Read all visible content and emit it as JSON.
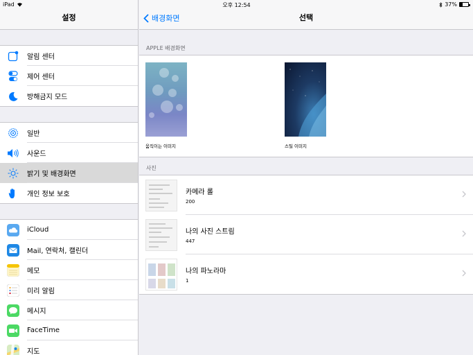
{
  "status": {
    "device": "iPad",
    "time": "오후 12:54",
    "battery": "37%",
    "battery_level": 0.37
  },
  "sidebar": {
    "title": "설정",
    "groups": [
      [
        {
          "label": "알림 센터",
          "icon": "notification-center-icon"
        },
        {
          "label": "제어 센터",
          "icon": "control-center-icon"
        },
        {
          "label": "방해금지 모드",
          "icon": "moon-icon"
        }
      ],
      [
        {
          "label": "일반",
          "icon": "gear-icon"
        },
        {
          "label": "사운드",
          "icon": "speaker-icon"
        },
        {
          "label": "밝기 및 배경화면",
          "icon": "brightness-icon",
          "selected": true
        },
        {
          "label": "개인 정보 보호",
          "icon": "hand-icon"
        }
      ],
      [
        {
          "label": "iCloud",
          "icon": "icloud-icon"
        },
        {
          "label": "Mail, 연락처, 캘린더",
          "icon": "mail-icon"
        },
        {
          "label": "메모",
          "icon": "notes-icon"
        },
        {
          "label": "미리 알림",
          "icon": "reminders-icon"
        },
        {
          "label": "메시지",
          "icon": "messages-icon"
        },
        {
          "label": "FaceTime",
          "icon": "facetime-icon"
        },
        {
          "label": "지도",
          "icon": "maps-icon"
        }
      ]
    ]
  },
  "main": {
    "back_label": "배경화면",
    "title": "선택",
    "apple_section": "APPLE 배경화면",
    "wallpapers": [
      {
        "caption": "움직이는 이미지"
      },
      {
        "caption": "스틸 이미지"
      }
    ],
    "photos_section": "사진",
    "albums": [
      {
        "name": "카메라 롤",
        "count": "200"
      },
      {
        "name": "나의 사진 스트림",
        "count": "447"
      },
      {
        "name": "나의 파노라마",
        "count": "1"
      }
    ]
  },
  "colors": {
    "accent": "#007aff",
    "selected_row": "#d9d9d9",
    "background": "#efeff4"
  }
}
